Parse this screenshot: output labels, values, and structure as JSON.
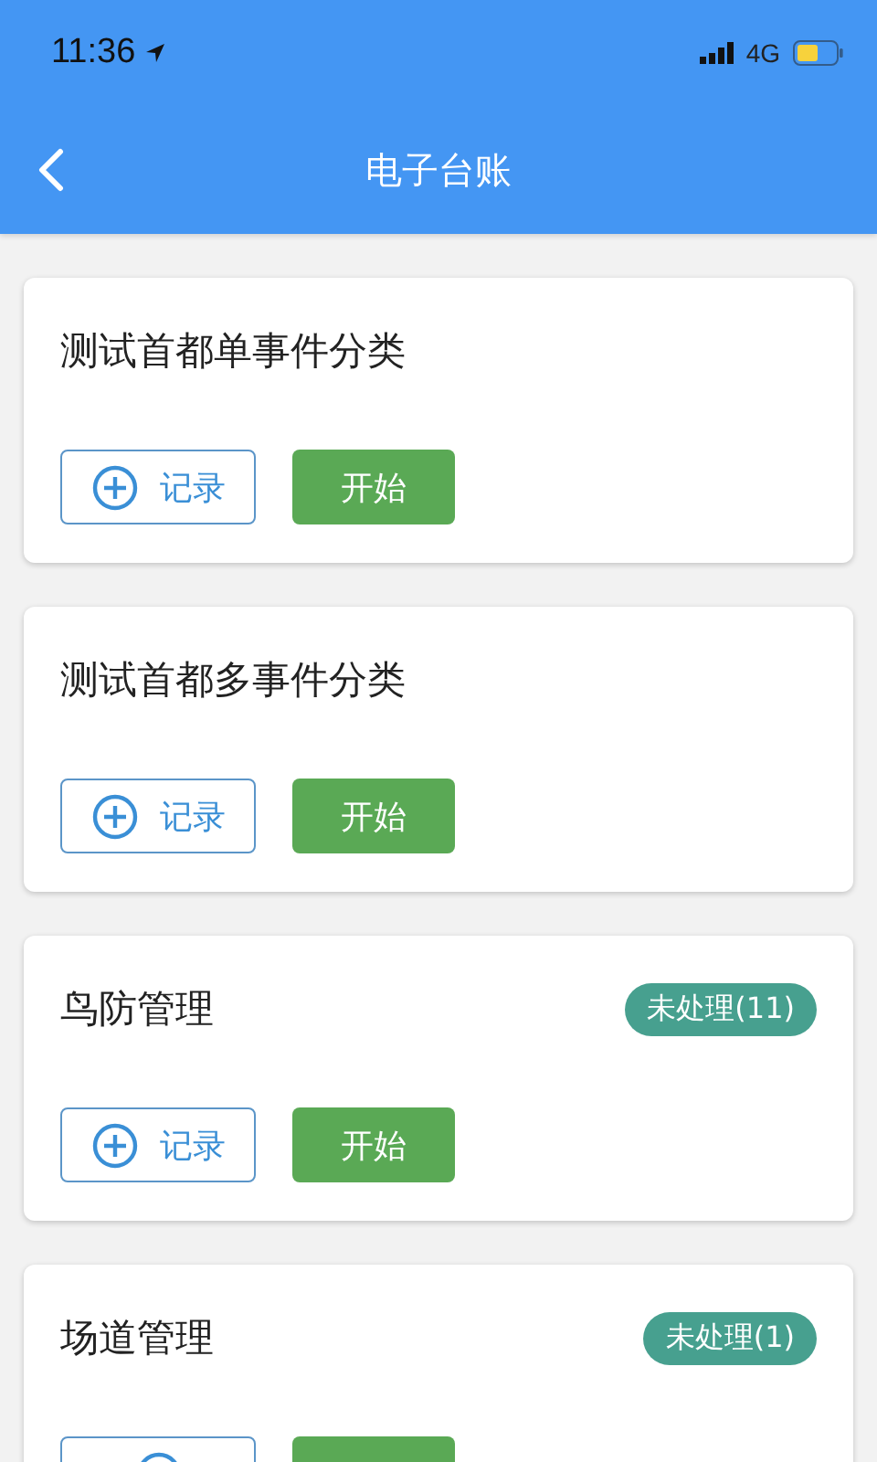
{
  "status_bar": {
    "time": "11:36",
    "network": "4G"
  },
  "nav": {
    "title": "电子台账"
  },
  "cards": [
    {
      "title": "测试首都单事件分类",
      "actions": [
        {
          "kind": "record",
          "label": "记录"
        },
        {
          "kind": "start",
          "label": "开始"
        }
      ]
    },
    {
      "title": "测试首都多事件分类",
      "actions": [
        {
          "kind": "record",
          "label": "记录"
        },
        {
          "kind": "start",
          "label": "开始"
        }
      ]
    },
    {
      "title": "鸟防管理",
      "badge": "未处理(11)",
      "actions": [
        {
          "kind": "record",
          "label": "记录"
        },
        {
          "kind": "start",
          "label": "开始"
        }
      ]
    },
    {
      "title": "场道管理",
      "badge": "未处理(1)",
      "actions": [
        {
          "kind": "record"
        },
        {
          "kind": "start"
        }
      ]
    }
  ]
}
